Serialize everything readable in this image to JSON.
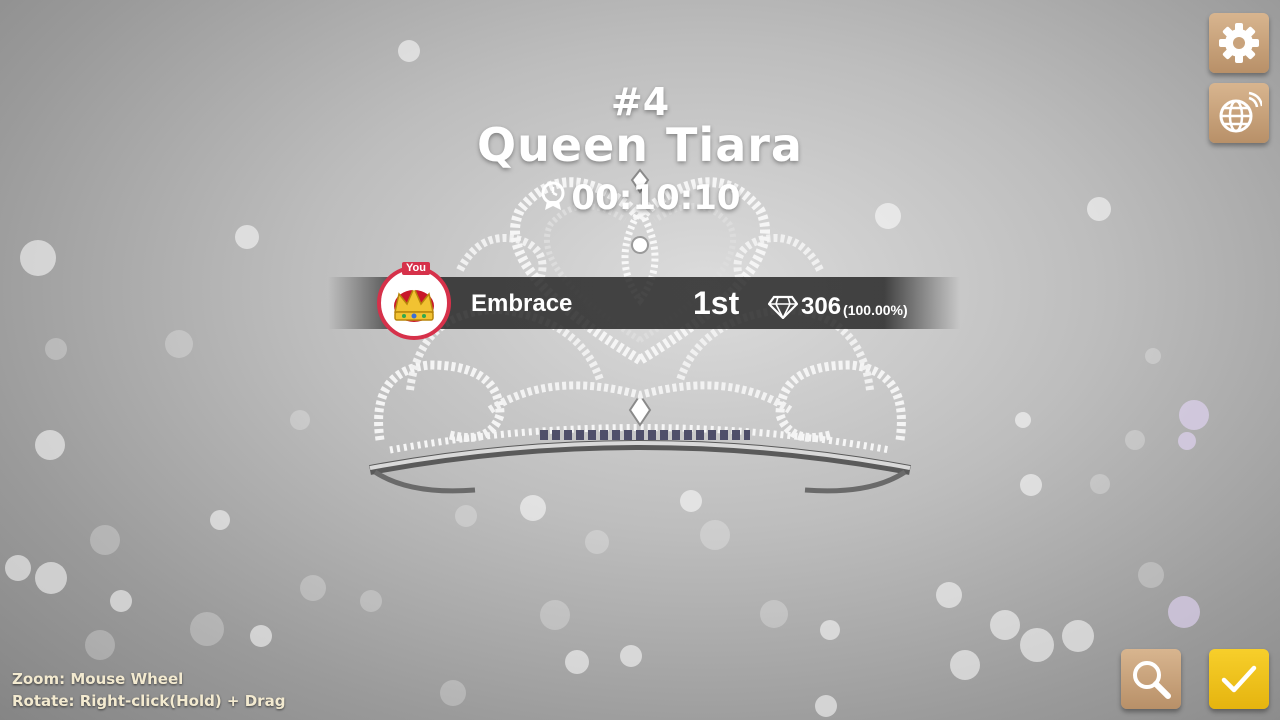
{
  "header": {
    "rank": "#4",
    "title": "Queen Tiara",
    "clear_time": "00:10:10"
  },
  "result": {
    "you_badge": "You",
    "player_name": "Embrace",
    "placement": "1st",
    "gems": "306",
    "gems_percent": "(100.00%)"
  },
  "controls_hint": {
    "zoom": "Zoom: Mouse Wheel",
    "rotate": "Rotate: Right-click(Hold) + Drag"
  },
  "icons": {
    "settings": "gear-icon",
    "language": "globe-icon",
    "zoom": "magnifier-icon",
    "confirm": "checkmark-icon",
    "timer": "stopwatch-icon",
    "gems": "diamond-icon",
    "avatar": "crown-icon"
  },
  "colors": {
    "accent_red": "#d6314a",
    "button_tan": "#c9a37c",
    "confirm_yellow": "#f0c51d",
    "hint_text": "#f3ead0"
  }
}
